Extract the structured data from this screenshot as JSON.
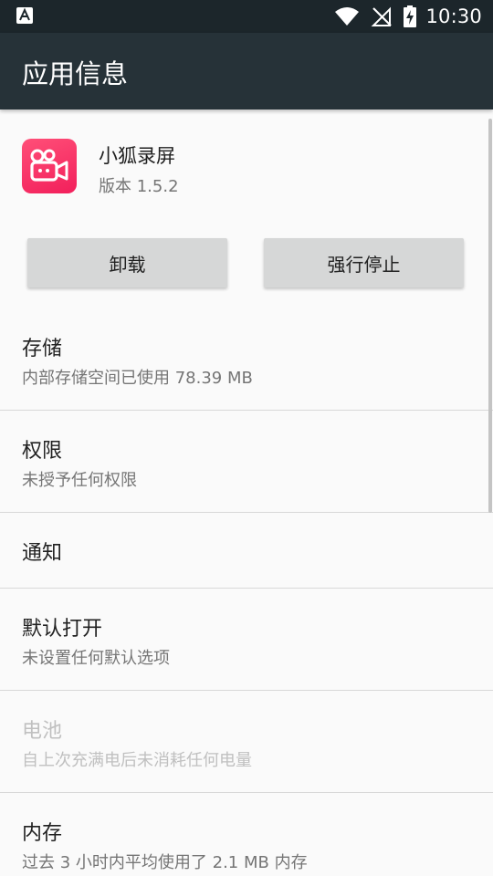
{
  "status_bar": {
    "time": "10:30",
    "notification_icon": "a-notification-icon",
    "wifi_icon": "wifi-icon",
    "signal_icon": "no-signal-icon",
    "battery_icon": "battery-charging-icon"
  },
  "app_bar": {
    "title": "应用信息"
  },
  "app": {
    "name": "小狐录屏",
    "version": "版本 1.5.2",
    "icon": "video-camera-icon",
    "icon_color": "#f72a62"
  },
  "buttons": {
    "uninstall": "卸载",
    "force_stop": "强行停止"
  },
  "items": [
    {
      "title": "存储",
      "subtitle": "内部存储空间已使用 78.39 MB"
    },
    {
      "title": "权限",
      "subtitle": "未授予任何权限"
    },
    {
      "title": "通知"
    },
    {
      "title": "默认打开",
      "subtitle": "未设置任何默认选项"
    },
    {
      "title": "电池",
      "subtitle": "自上次充满电后未消耗任何电量",
      "disabled": true
    },
    {
      "title": "内存",
      "subtitle": "过去 3 小时内平均使用了 2.1 MB 内存"
    }
  ],
  "colors": {
    "app_bar": "#263238",
    "status_bar": "#1c262b",
    "button": "#d6d7d7",
    "background": "#fafafa"
  }
}
